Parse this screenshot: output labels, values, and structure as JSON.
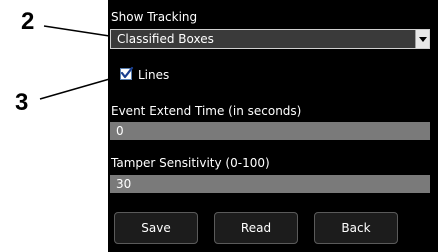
{
  "callouts": {
    "first": "2",
    "second": "3"
  },
  "tracking": {
    "label": "Show Tracking",
    "selected": "Classified Boxes",
    "lines_label": "Lines",
    "lines_checked": true
  },
  "event_extend": {
    "label": "Event Extend Time (in seconds)",
    "value": "0"
  },
  "tamper": {
    "label": "Tamper Sensitivity (0-100)",
    "value": "30"
  },
  "buttons": {
    "save": "Save",
    "read": "Read",
    "back": "Back"
  },
  "colors": {
    "panel_bg": "#000000",
    "field_bg": "#7a7a7a",
    "select_bg": "#3a3a3a",
    "button_bg": "#1c1c1c",
    "text": "#ffffff"
  }
}
